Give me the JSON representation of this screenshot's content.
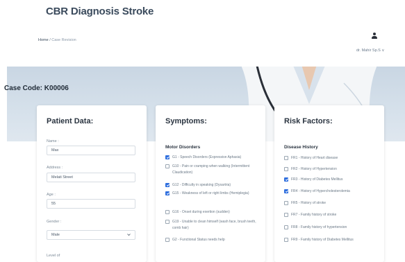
{
  "header": {
    "app_title": "CBR Diagnosis Stroke",
    "breadcrumb_home": "Home",
    "breadcrumb_separator": " / ",
    "breadcrumb_current": "Case Revision",
    "user_name": "dr. Mahir Sp.S ∨",
    "user_icon": "user-icon"
  },
  "case": {
    "label": "Case Code: K00006"
  },
  "patient": {
    "title": "Patient Data:",
    "name_label": "Name :",
    "name_value": "Max",
    "address_label": "Address :",
    "address_value": "Melati Street",
    "age_label": "Age :",
    "age_value": "55",
    "gender_label": "Gender :",
    "gender_value": "Male",
    "level_label": "Level of"
  },
  "symptoms": {
    "title": "Symptoms:",
    "group": "Motor Disorders",
    "items": [
      {
        "text": "G1 - Speech Disorders (Expressive Aphasia)",
        "checked": true
      },
      {
        "text": "G10 - Pain or cramping when walking (Intermittent Claudication)",
        "checked": false
      },
      {
        "text": "G12 - Difficulty in speaking (Dysartria)",
        "checked": true
      },
      {
        "text": "G15 - Weakness of left or right limbs (Hemiplegia)",
        "checked": true
      },
      {
        "text": "G16 - Onset during exertion (sudden)",
        "checked": false
      },
      {
        "text": "G19 - Unable to clean himself (wash face, brush teeth, comb hair)",
        "checked": false
      },
      {
        "text": "G2 - Functional Status needs help",
        "checked": false
      }
    ]
  },
  "risk": {
    "title": "Risk Factors:",
    "group": "Disease History",
    "items": [
      {
        "text": "FR1 - History of Heart disease",
        "checked": false
      },
      {
        "text": "FR2 - History of Hypertension",
        "checked": false
      },
      {
        "text": "FR3 - History of Diabetes Mellitus",
        "checked": true
      },
      {
        "text": "FR4 - History of Hypercholesterolemia",
        "checked": true
      },
      {
        "text": "FR5 - History of stroke",
        "checked": false
      },
      {
        "text": "FR7 - Family history of stroke",
        "checked": false
      },
      {
        "text": "FR8 - Family history of hypertension",
        "checked": false
      },
      {
        "text": "FR9 - Family history of Diabetes Mellitus",
        "checked": false
      }
    ]
  },
  "colors": {
    "accent": "#2f6fde",
    "title_text": "#3a4a5c",
    "hero_bg": "#cfdbe6"
  }
}
